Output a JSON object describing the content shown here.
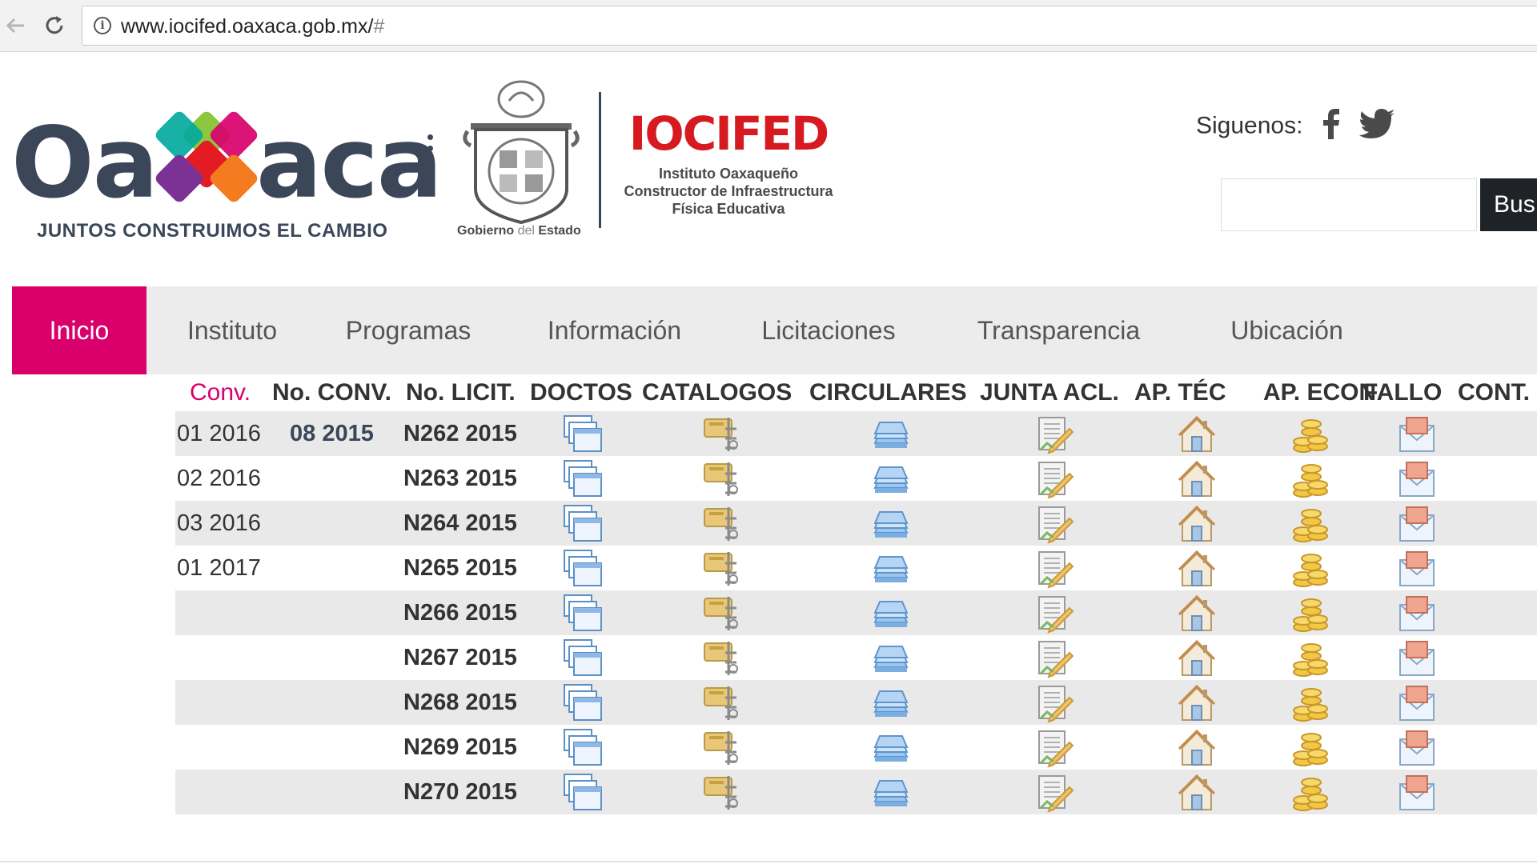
{
  "browser": {
    "url": "www.iocifed.oaxaca.gob.mx/",
    "url_hash": "#"
  },
  "header": {
    "oaxaca_logo": {
      "word_left": "Oa",
      "word_right": "aca",
      "slogan": "JUNTOS CONSTRUIMOS EL CAMBIO"
    },
    "gobierno_label_strong": "Gobierno",
    "gobierno_label_thin": "del",
    "gobierno_label_end": "Estado",
    "iocifed": {
      "title": "IOCIFED",
      "line1": "Instituto Oaxaqueño",
      "line2": "Constructor de Infraestructura",
      "line3": "Física Educativa"
    },
    "follow_label": "Siguenos:",
    "search_button": "Bus",
    "colors": {
      "accent": "#d9006c",
      "brand_dark": "#3b4659",
      "iocifed_red": "#d71920"
    }
  },
  "nav": {
    "items": [
      {
        "label": "Inicio",
        "active": true
      },
      {
        "label": "Instituto",
        "active": false
      },
      {
        "label": "Programas",
        "active": false
      },
      {
        "label": "Información",
        "active": false
      },
      {
        "label": "Licitaciones",
        "active": false
      },
      {
        "label": "Transparencia",
        "active": false
      },
      {
        "label": "Ubicación",
        "active": false
      }
    ]
  },
  "table": {
    "headers": [
      "Conv.",
      "No. CONV.",
      "No. LICIT.",
      "DOCTOS",
      "CATALOGOS",
      "CIRCULARES",
      "JUNTA ACL.",
      "AP. TÉC",
      "AP. ECON",
      "FALLO",
      "CONT."
    ],
    "icons": [
      "documents-icon",
      "catalog-icon",
      "circulars-icon",
      "clarification-meeting-icon",
      "technical-opening-icon",
      "economic-opening-icon",
      "contract-icon"
    ],
    "rows": [
      {
        "conv": "01 2016",
        "no_conv": "08 2015",
        "no_licit": "N262 2015"
      },
      {
        "conv": "02 2016",
        "no_conv": "",
        "no_licit": "N263 2015"
      },
      {
        "conv": "03 2016",
        "no_conv": "",
        "no_licit": "N264 2015"
      },
      {
        "conv": "01 2017",
        "no_conv": "",
        "no_licit": "N265 2015"
      },
      {
        "conv": "",
        "no_conv": "",
        "no_licit": "N266 2015"
      },
      {
        "conv": "",
        "no_conv": "",
        "no_licit": "N267 2015"
      },
      {
        "conv": "",
        "no_conv": "",
        "no_licit": "N268 2015"
      },
      {
        "conv": "",
        "no_conv": "",
        "no_licit": "N269 2015"
      },
      {
        "conv": "",
        "no_conv": "",
        "no_licit": "N270 2015"
      }
    ]
  }
}
